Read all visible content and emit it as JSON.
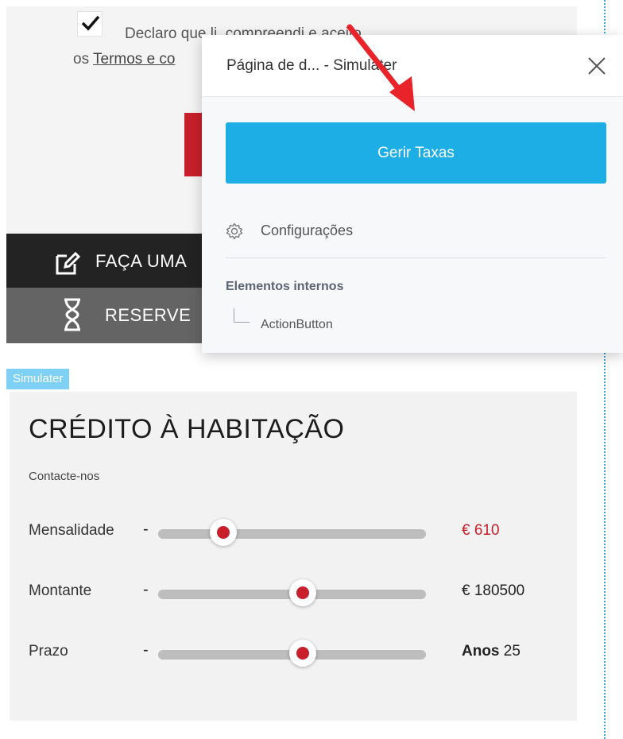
{
  "consent": {
    "checked": true,
    "line1": "Declaro que li, compreendi e aceito",
    "line2_prefix": "os ",
    "link_text": "Termos e co"
  },
  "banners": {
    "quote_label": "FAÇA UMA",
    "reserve_label": "RESERVE"
  },
  "simulator_tag": "Simulater",
  "simulator": {
    "title": "CRÉDITO À HABITAÇÃO",
    "contact_label": "Contacte-nos",
    "rows": [
      {
        "label": "Mensalidade",
        "minus": "-",
        "value": "€ 610",
        "value_color": "#c8202a"
      },
      {
        "label": "Montante",
        "minus": "-",
        "value": "€ 180500",
        "value_color": "#222222"
      },
      {
        "label": "Prazo",
        "minus": "-",
        "value_prefix": "Anos",
        "value": "25",
        "value_color": "#222222"
      }
    ]
  },
  "popup": {
    "title": "Página de d...  - Simulater",
    "primary_button": "Gerir Taxas",
    "settings_label": "Configurações",
    "section_label": "Elementos internos",
    "child_item": "ActionButton"
  },
  "colors": {
    "brand_red": "#c8202a",
    "primary_blue": "#1eaee6",
    "tag_blue": "#7fd0f5",
    "annotation_red": "#e8232a"
  },
  "icons": [
    "checkmark-icon",
    "edit-icon",
    "hourglass-icon",
    "close-icon",
    "gear-icon"
  ]
}
